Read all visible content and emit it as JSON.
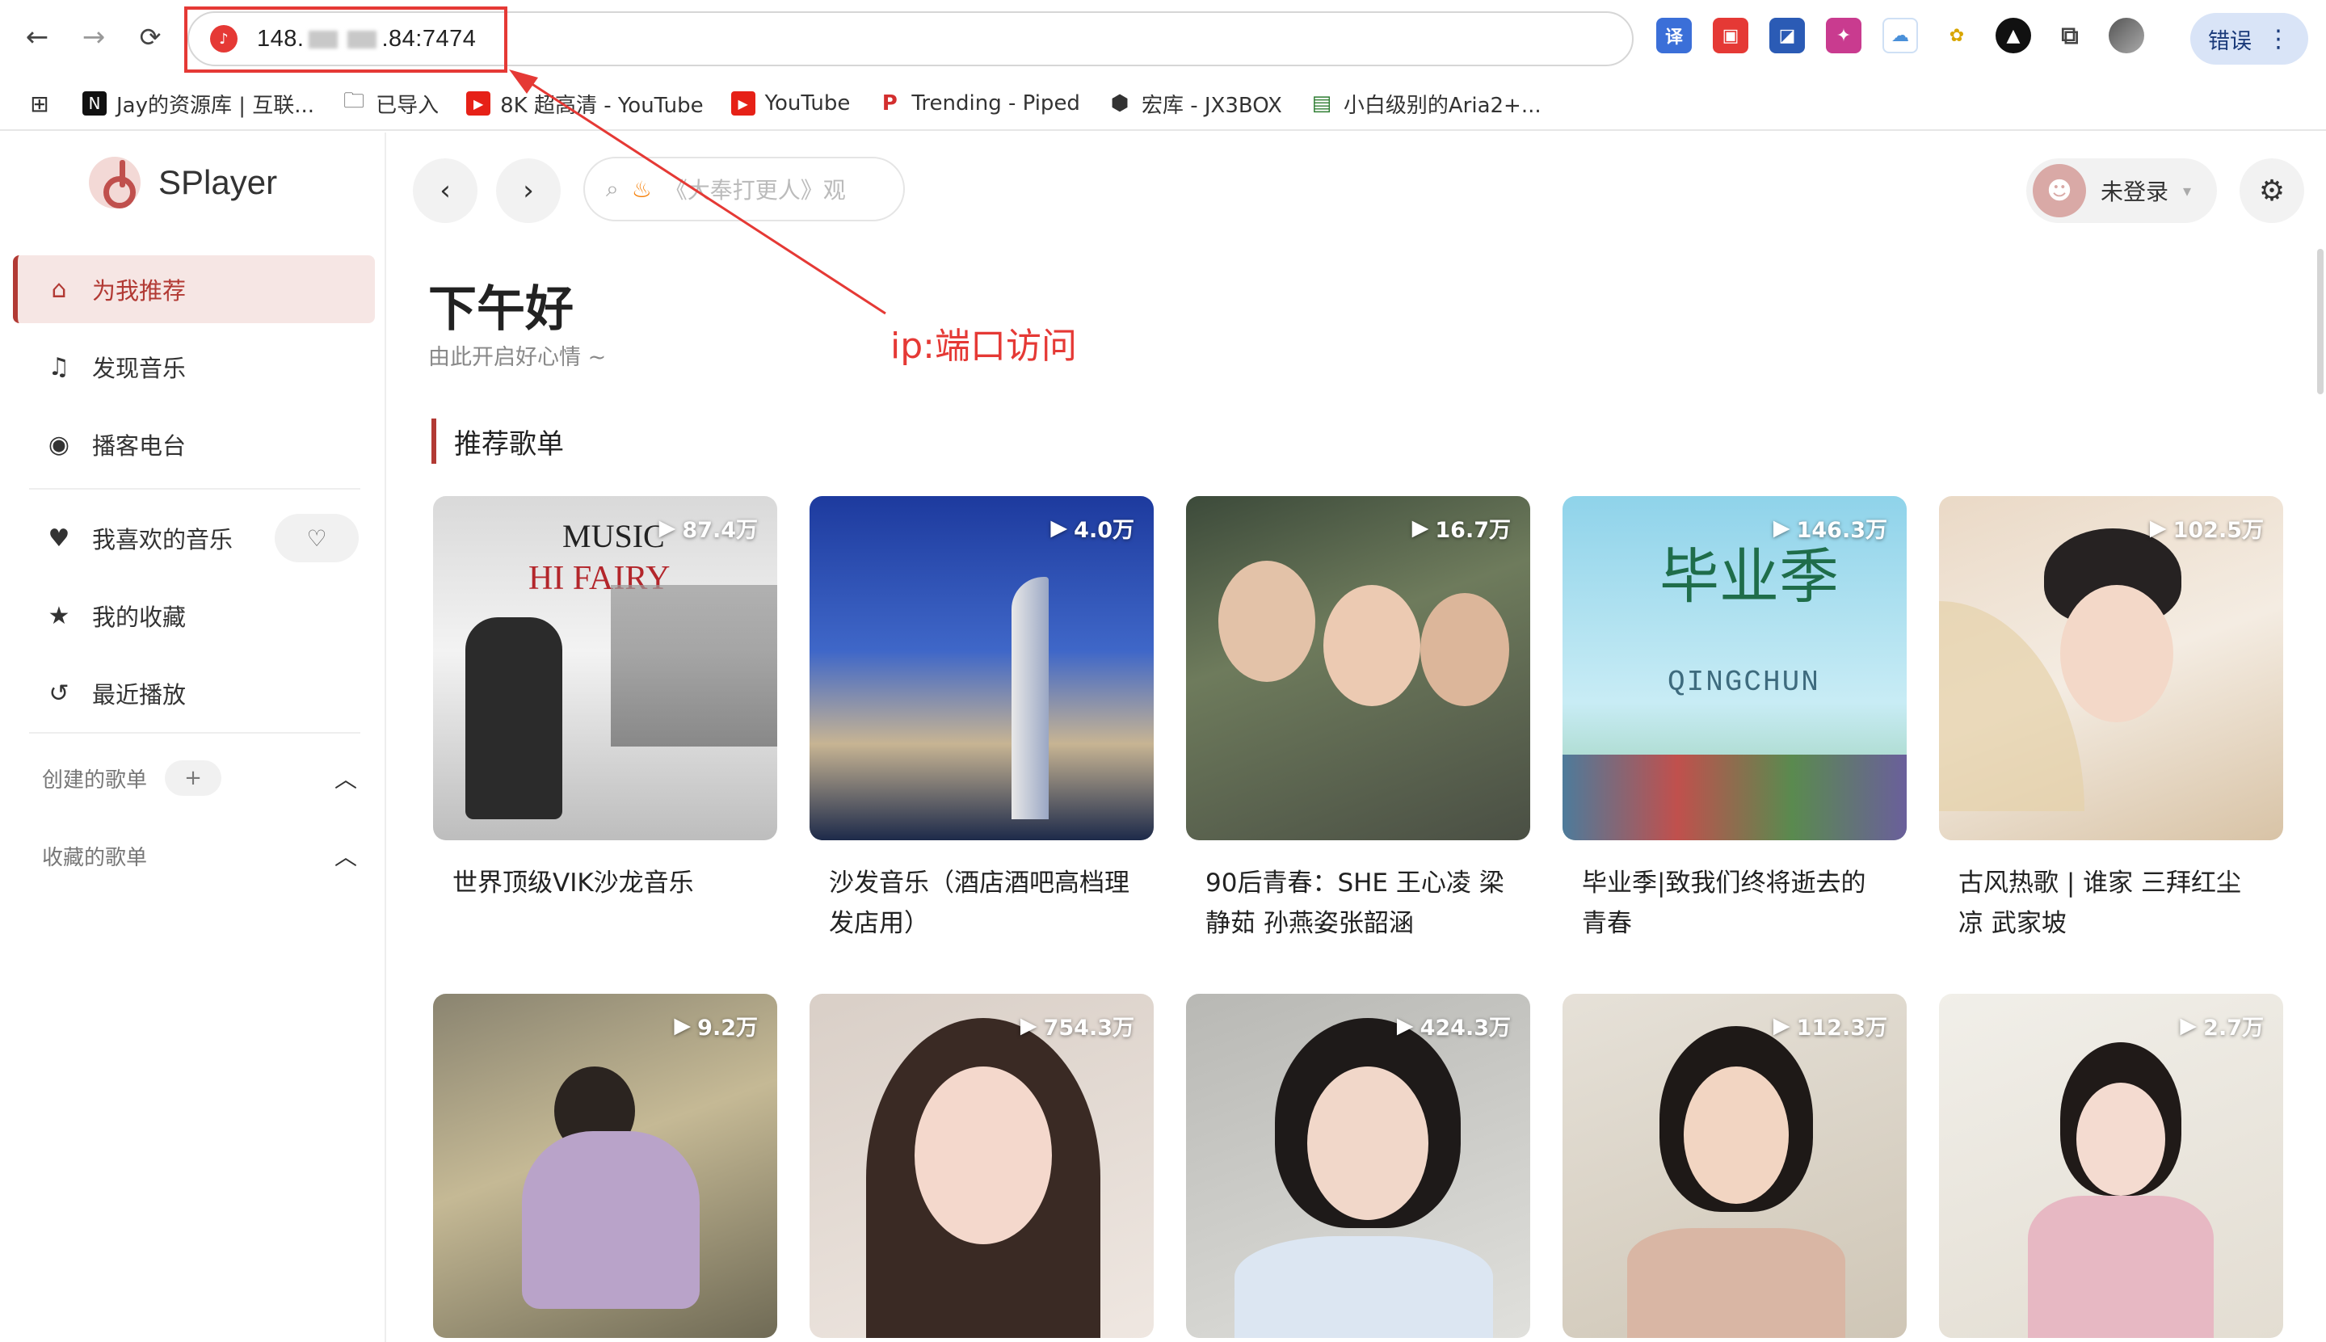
{
  "browser": {
    "url_prefix": "148.",
    "url_suffix": ".84:7474",
    "error_label": "错误",
    "bookmarks": [
      {
        "label": "Jay的资源库 | 互联...",
        "icon": "notion-icon"
      },
      {
        "label": "已导入",
        "icon": "folder-icon"
      },
      {
        "label": "8K 超高清 - YouTube",
        "icon": "youtube-icon"
      },
      {
        "label": "YouTube",
        "icon": "youtube-icon"
      },
      {
        "label": "Trending - Piped",
        "icon": "piped-icon"
      },
      {
        "label": "宏库 - JX3BOX",
        "icon": "jx3box-icon"
      },
      {
        "label": "小白级别的Aria2+...",
        "icon": "page-icon"
      }
    ]
  },
  "annotation": {
    "label": "ip:端口访问"
  },
  "app": {
    "name": "SPlayer",
    "menu": [
      {
        "label": "为我推荐",
        "icon": "home-icon"
      },
      {
        "label": "发现音乐",
        "icon": "music-note-icon"
      },
      {
        "label": "播客电台",
        "icon": "podcast-icon"
      },
      {
        "label": "我喜欢的音乐",
        "icon": "heart-icon"
      },
      {
        "label": "我的收藏",
        "icon": "star-icon"
      },
      {
        "label": "最近播放",
        "icon": "history-icon"
      }
    ],
    "created_playlists_label": "创建的歌单",
    "collected_playlists_label": "收藏的歌单",
    "search_placeholder": "《大奉打更人》观",
    "login_label": "未登录",
    "greeting": "下午好",
    "greeting_sub": "由此开启好心情 ~",
    "section_title": "推荐歌单",
    "playlists": [
      {
        "title": "世界顶级VIK沙龙音乐",
        "plays": "87.4万",
        "art_line1": "MUSIC",
        "art_line2": "HI FAIRY"
      },
      {
        "title": "沙发音乐（酒店酒吧高档理发店用）",
        "plays": "4.0万"
      },
      {
        "title": "90后青春：SHE 王心凌 梁静茹 孙燕姿张韶涵",
        "plays": "16.7万"
      },
      {
        "title": "毕业季|致我们终将逝去的青春",
        "plays": "146.3万",
        "art_line1": "毕业季",
        "art_line2": "QINGCHUN"
      },
      {
        "title": "古风热歌 | 谁家 三拜红尘凉 武家坡",
        "plays": "102.5万"
      },
      {
        "title": "",
        "plays": "9.2万"
      },
      {
        "title": "",
        "plays": "754.3万"
      },
      {
        "title": "",
        "plays": "424.3万"
      },
      {
        "title": "",
        "plays": "112.3万"
      },
      {
        "title": "",
        "plays": "2.7万"
      }
    ]
  },
  "colors": {
    "accent": "#b23a34",
    "annotation": "#e53935"
  }
}
